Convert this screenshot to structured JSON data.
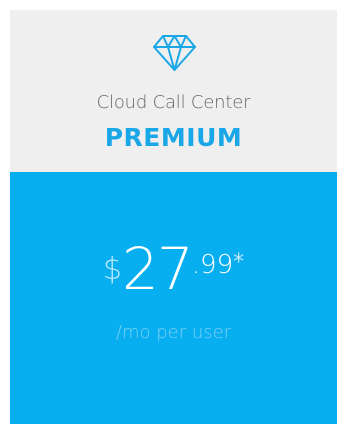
{
  "plan": {
    "subtitle": "Cloud Call Center",
    "name": "PREMIUM",
    "icon": "diamond-icon"
  },
  "pricing": {
    "currency": "$",
    "amount": "27",
    "cents": ".99",
    "asterisk": "*",
    "per_user": "/mo per user"
  },
  "colors": {
    "header_bg": "#efefef",
    "accent": "#1aa7e8",
    "body_bg": "#07aef0"
  }
}
